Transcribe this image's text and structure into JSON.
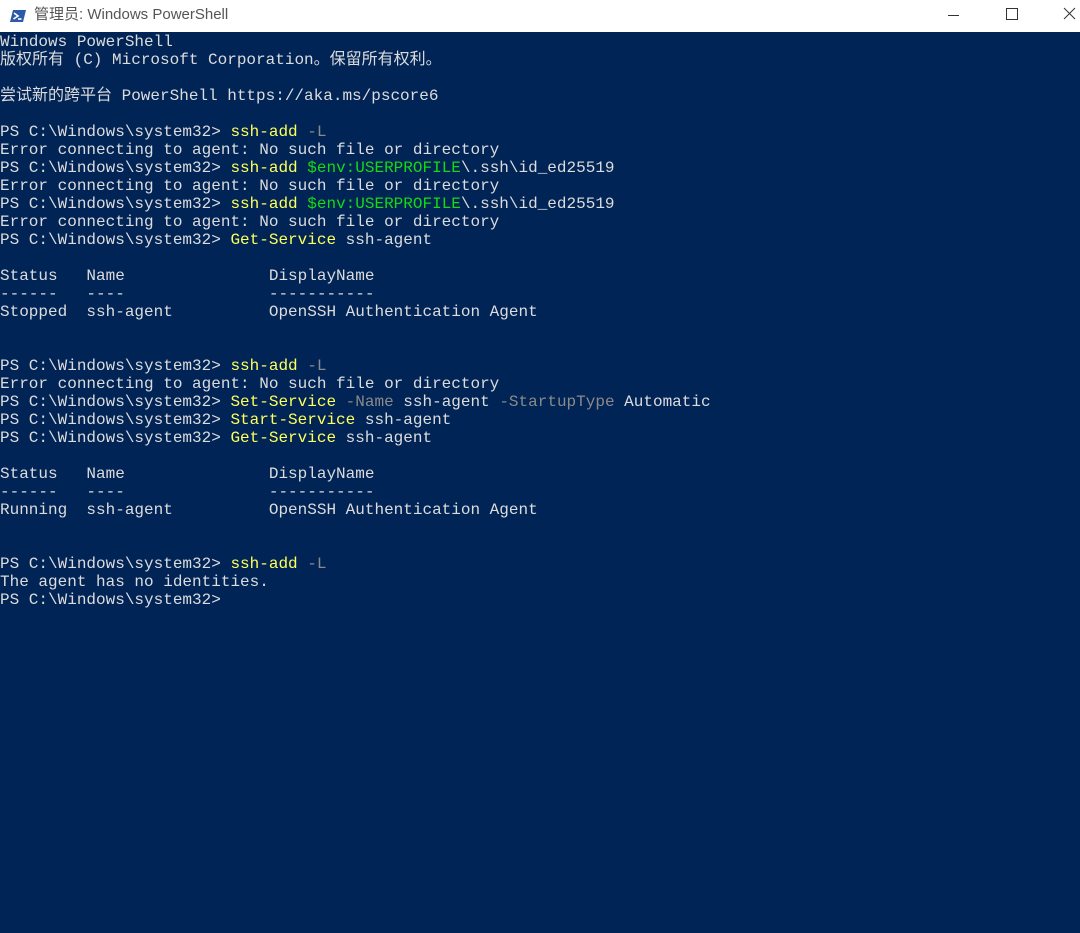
{
  "window": {
    "title": "管理员: Windows PowerShell",
    "icon": "powershell-icon",
    "controls": {
      "minimize": "minimize-icon",
      "maximize": "maximize-icon",
      "close": "close-icon"
    }
  },
  "colors": {
    "console_bg": "#012456",
    "text": "#dcdcdc",
    "command": "#ffff5a",
    "parameter": "#8a8a8a",
    "variable": "#15d915"
  },
  "terminal": {
    "header_line1": "Windows PowerShell",
    "header_line2": "版权所有 (C) Microsoft Corporation。保留所有权利。",
    "header_line3": "尝试新的跨平台 PowerShell https://aka.ms/pscore6",
    "prompt": "PS C:\\Windows\\system32> ",
    "cmd_ssh_add": "ssh-add",
    "param_L": "-L",
    "err_msg": "Error connecting to agent: No such file or directory",
    "var_userprofile": "$env:USERPROFILE",
    "path_key": "\\.ssh\\id_ed25519",
    "cmd_get_service": "Get-Service",
    "arg_ssh_agent": "ssh-agent",
    "table_header": "Status   Name               DisplayName",
    "table_divider": "------   ----               -----------",
    "row_stopped": "Stopped  ssh-agent          OpenSSH Authentication Agent",
    "cmd_set_service": "Set-Service",
    "param_name": "-Name",
    "param_startup": "-StartupType",
    "arg_automatic": "Automatic",
    "cmd_start_service": "Start-Service",
    "row_running": "Running  ssh-agent          OpenSSH Authentication Agent",
    "no_identities": "The agent has no identities."
  }
}
